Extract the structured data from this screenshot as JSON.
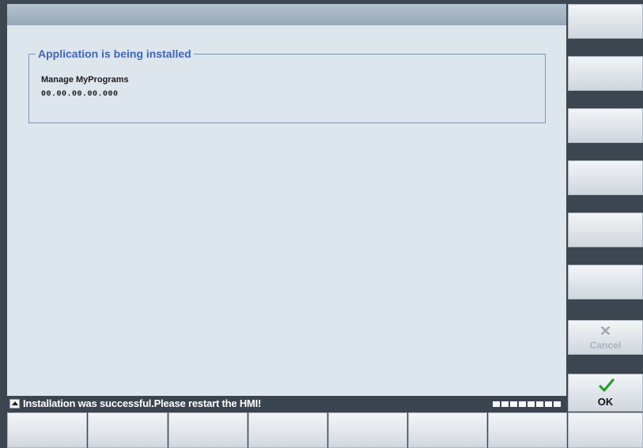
{
  "dialog": {
    "group_title": "Application is being installed",
    "app_name": "Manage MyPrograms",
    "app_version": "00.00.00.00.000"
  },
  "status_bar": {
    "message": "Installation was successful.Please restart the HMI!",
    "progress_segments": 8
  },
  "vertical_softkeys": [
    {
      "label": ""
    },
    {
      "label": ""
    },
    {
      "label": ""
    },
    {
      "label": ""
    },
    {
      "label": ""
    },
    {
      "label": ""
    },
    {
      "label": "Cancel",
      "icon": "cancel-x-icon",
      "enabled": false
    },
    {
      "label": "OK",
      "icon": "checkmark-icon",
      "enabled": true
    }
  ],
  "horizontal_softkeys": [
    {
      "label": ""
    },
    {
      "label": ""
    },
    {
      "label": ""
    },
    {
      "label": ""
    },
    {
      "label": ""
    },
    {
      "label": ""
    },
    {
      "label": ""
    },
    {
      "label": ""
    }
  ],
  "colors": {
    "title_blue": "#3e67b8",
    "check_green": "#2e9a2e",
    "status_bg": "#3b4550"
  }
}
